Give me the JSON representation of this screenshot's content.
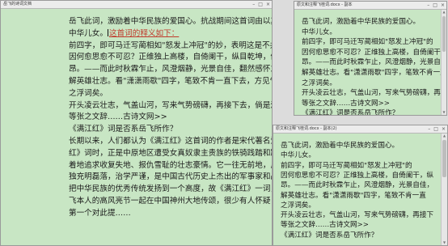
{
  "windows": {
    "main": {
      "title": "岳飞的诗词文档",
      "lines": [
        "岳飞此词，激励着中华民族的爱国心。抗战期间这首词由以其低回",
        "中华儿女。",
        "前四字，即可马迁写蔺相如\"怒发上冲冠\"的妙，表明这是不共戴天的",
        "因何愈思愈不可忍？正维独上高楼，自倚阑干，纵目乾坤，俯仰六合，",
        "昂。——而此时秋霖乍止，风澄烟静，光景自佳，翻然感怀之怀，于是",
        "解英雄壮志。看\"潇潇雨歇\"四字，笔致不肯一直下去，方见气度渊静",
        "之浮词矣。",
        "开头凌云壮志，气盖山河，写来气势磅礴，再接下去，倘是满手，有意",
        "等张之文辞……古诗文网>>",
        "《满江红》词是否系岳飞所作？",
        "长期以来，人们都认为《满江红》这首词的作者是宋代著名爱国将领岳飞",
        "红》词时，正是中原地区遭受女真奴隶主贵族的铁骑践踏和蹂躏的岁月",
        "着地追求收复失地、报仇雪耻的壮志豪情。它一往无前地，反对投降，代表",
        "独充明磊落，治学严谨，是中国古代历史上杰出的军事家和战略家，他是",
        "把中华民族的优秀传统发扬到一个高度，故《满江红》一词，一直作为岳",
        "飞本人的高风亮节一起在中国神州大地传颂，很少有人怀疑《满江红》",
        "第一个对此提……"
      ],
      "highlight": "这首词的释义如下：",
      "caret_line": 1
    },
    "top_right": {
      "title": "原文和注释飞桂词.docx - 副本",
      "lines": [
        "岳飞此词，激励着中华民族的爱国心。",
        "中华儿女。",
        "前四字，即可马迁写蔺相如\"怒发上冲冠\"的",
        "因何愈思愈不可忍？正维独上高楼，自倚阑干，纵",
        "昂。——而此时秋霖乍止，风澄烟静，光景自佳，",
        "解英雄壮志。看\"潇潇雨歇\"四字，笔致不肯一直",
        "之浮词矣。",
        "开头凌云壮志，气盖山河，写来气势磅礴，再接下",
        "等张之文辞……古诗文网>>",
        "《满江红》词是否系岳飞所作？"
      ]
    },
    "bottom_right": {
      "title": "原文和注释飞桂词.docx - 副本(2)",
      "lines": [
        "岳飞此词，激励着中华民族的爱国心。",
        "中华儿女。",
        "前四字，即可马迁写蔺相如\"怒发上冲冠\"的",
        "因何愈思愈不可忍？正维独上高楼，自倚阑干，纵",
        "昂。——而此时秋霖乍止，风澄烟静，光景自佳，",
        "解英雄壮志。看\"潇潇雨歇\"四字，笔致不肯一直",
        "之浮词矣。",
        "开头凌云壮志，气盖山河，写来气势磅礴，再接下",
        "等张之文辞……古诗文网>>",
        "《满江红》词是否系岳飞所作？"
      ]
    }
  },
  "colors": {
    "paper": "#c8e6c4",
    "highlight": "#c0392b",
    "titlebar": "#ececec"
  },
  "icons": {
    "minimize": "minimize-icon",
    "maximize": "maximize-icon",
    "close": "close-icon"
  }
}
